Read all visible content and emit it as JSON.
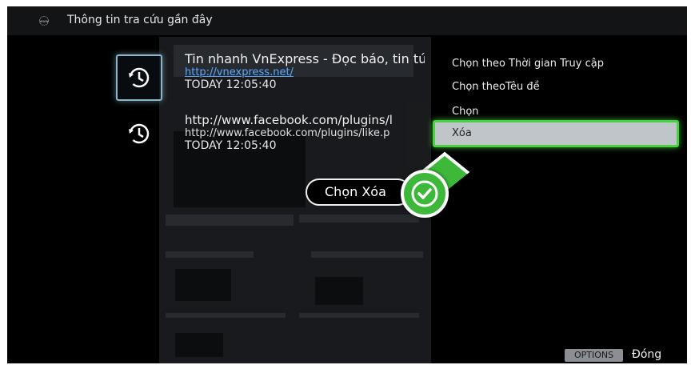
{
  "header": {
    "icon": "www-icon",
    "title": "Thông tin tra cứu gần đây"
  },
  "entries": [
    {
      "title": "Tin nhanh VnExpress - Đọc báo, tin tứ",
      "url": "http://vnexpress.net/",
      "time": "TODAY 12:05:40"
    },
    {
      "title": "http://www.facebook.com/plugins/l",
      "url": "http://www.facebook.com/plugins/like.p",
      "time": "TODAY 12:05:40"
    }
  ],
  "menu": {
    "items": [
      {
        "label": "Chọn theo Thời gian Truy cập"
      },
      {
        "label": "Chọn theoTêu đề"
      },
      {
        "label": "Chọn"
      },
      {
        "label": "Xóa"
      }
    ],
    "selected_index": 3
  },
  "action": {
    "label": "Chọn Xóa"
  },
  "footer": {
    "options_label": "OPTIONS",
    "close_label": "Đóng"
  },
  "colors": {
    "accent": "#3db83a",
    "link": "#5aa9ff",
    "highlight_border": "#47d23f"
  }
}
